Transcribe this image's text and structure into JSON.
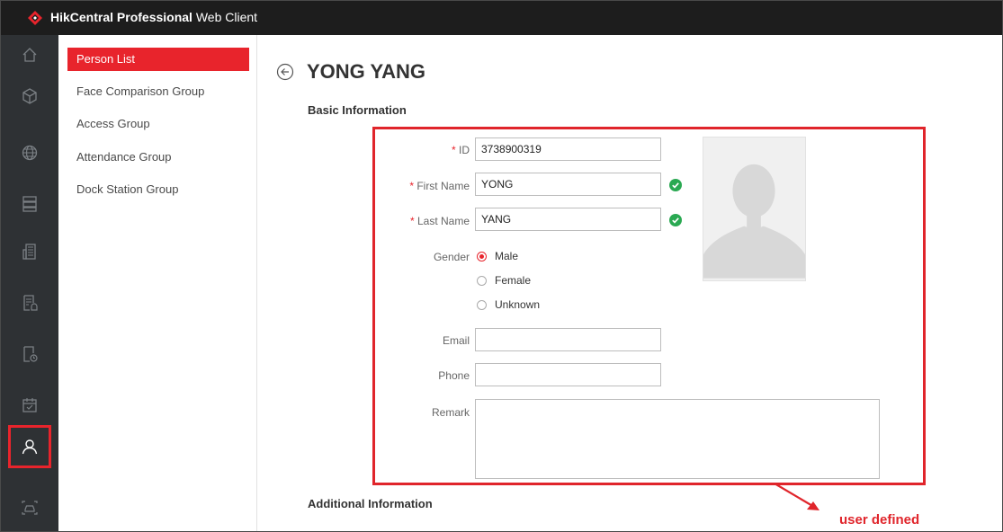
{
  "app": {
    "title_bold": "HikCentral Professional",
    "title_rest": " Web Client",
    "brand_color": "#e8242c"
  },
  "iconbar": {
    "items": [
      {
        "name": "home-icon"
      },
      {
        "name": "cube-icon"
      },
      {
        "name": "globe-icon"
      },
      {
        "name": "server-icon"
      },
      {
        "name": "building-icon"
      },
      {
        "name": "document-alarm-icon"
      },
      {
        "name": "document-clock-icon"
      },
      {
        "name": "calendar-check-icon"
      },
      {
        "name": "person-icon",
        "active": true
      },
      {
        "name": "vehicle-icon"
      }
    ]
  },
  "sidebar": {
    "items": [
      {
        "label": "Person List",
        "active": true
      },
      {
        "label": "Face Comparison Group"
      },
      {
        "label": "Access Group"
      },
      {
        "label": "Attendance Group"
      },
      {
        "label": "Dock Station Group"
      }
    ]
  },
  "main": {
    "title": "YONG YANG",
    "basic_info_title": "Basic Information",
    "additional_info_title": "Additional Information",
    "form": {
      "required_mark": "*",
      "id_label": " ID",
      "id_value": "3738900319",
      "first_name_label": " First Name",
      "first_name_value": "YONG",
      "last_name_label": " Last Name",
      "last_name_value": "YANG",
      "gender_label": "Gender",
      "gender_options": [
        "Male",
        "Female",
        "Unknown"
      ],
      "gender_selected": "Male",
      "email_label": "Email",
      "email_value": "",
      "phone_label": "Phone",
      "phone_value": "",
      "remark_label": "Remark",
      "remark_value": ""
    }
  },
  "annotation": {
    "text": "user defined",
    "color": "#e0252b"
  }
}
